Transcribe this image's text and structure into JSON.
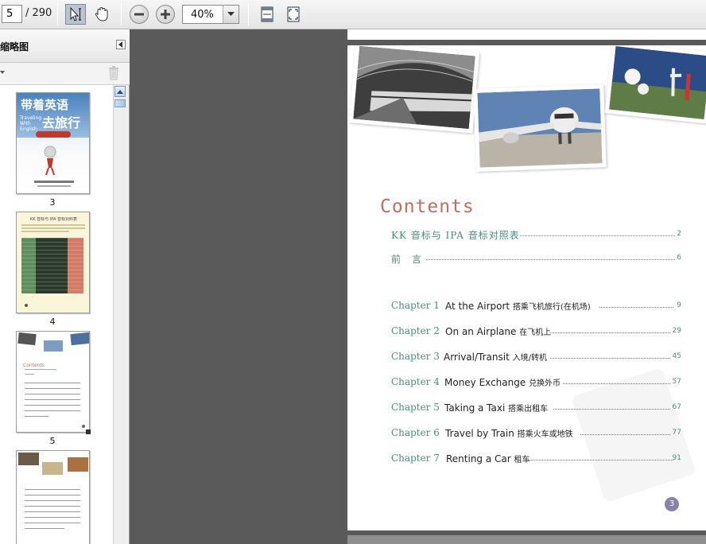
{
  "toolbar": {
    "page_current": "5",
    "page_total": "/ 290",
    "zoom": "40%"
  },
  "sidebar": {
    "title": "缩略图",
    "thumbnails": [
      {
        "label": "3"
      },
      {
        "label": "4"
      },
      {
        "label": "5"
      },
      {
        "label": ""
      }
    ]
  },
  "thumb3": {
    "title_line1": "带着英语",
    "title_line2": "去旅行",
    "subtitle": "Traveling With English"
  },
  "thumb4": {
    "heading": "KK 音标与 IPA 音标对照表"
  },
  "thumb5": {
    "heading": "Contents"
  },
  "document": {
    "contents_title": "Contents",
    "page_number": "3",
    "front_matter": [
      {
        "label": "KK 音标与 IPA 音标对照表",
        "page": "2"
      },
      {
        "label": "前　言",
        "page": "6"
      }
    ],
    "chapters": [
      {
        "chapter": "Chapter 1",
        "title_en": "At the Airport",
        "title_cn": "搭乘飞机旅行(在机场)",
        "page": "9"
      },
      {
        "chapter": "Chapter 2",
        "title_en": "On an Airplane",
        "title_cn": "在飞机上",
        "page": "29"
      },
      {
        "chapter": "Chapter 3",
        "title_en": "Arrival/Transit",
        "title_cn": "入境/转机",
        "page": "45"
      },
      {
        "chapter": "Chapter 4",
        "title_en": "Money Exchange",
        "title_cn": "兑换外币",
        "page": "57"
      },
      {
        "chapter": "Chapter 5",
        "title_en": "Taking a Taxi",
        "title_cn": "搭乘出租车",
        "page": "67"
      },
      {
        "chapter": "Chapter 6",
        "title_en": "Travel by Train",
        "title_cn": "搭乘火车或地铁",
        "page": "77"
      },
      {
        "chapter": "Chapter 7",
        "title_en": "Renting a Car",
        "title_cn": "租车",
        "page": "91"
      }
    ]
  },
  "colors": {
    "chapter_text": "#4c8b78",
    "contents_title": "#c0705c",
    "page_badge": "#8a82a8"
  }
}
